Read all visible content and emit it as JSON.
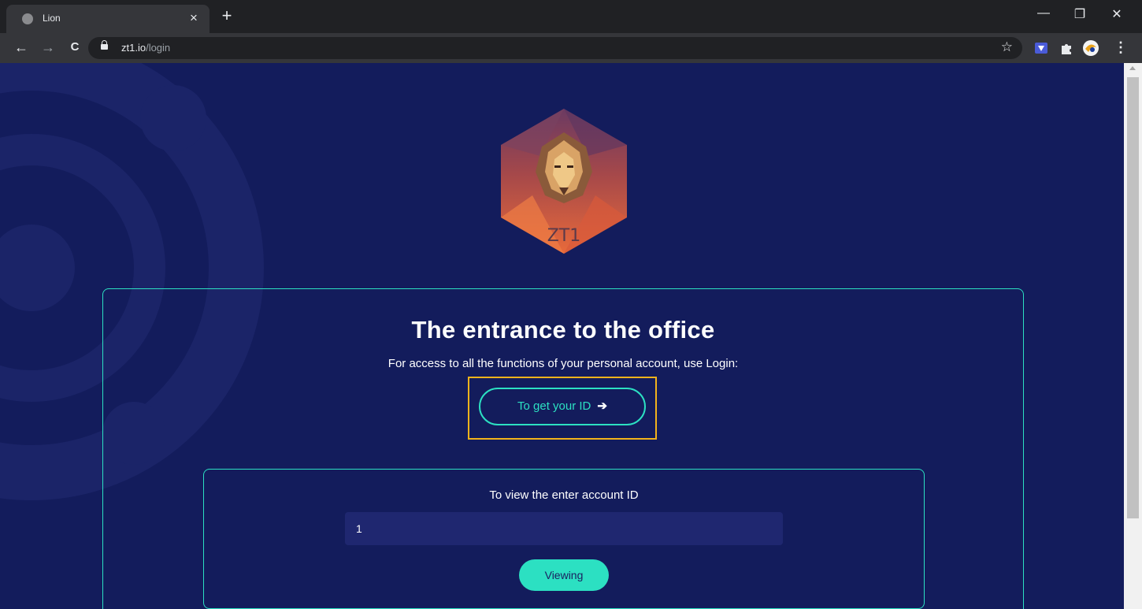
{
  "browser": {
    "tab_title": "Lion",
    "tab_close": "×",
    "new_tab": "+",
    "url_domain": "zt1.io",
    "url_path": "/login",
    "window": {
      "minimize": "—",
      "restore": "❐",
      "close": "✕"
    },
    "nav": {
      "back": "←",
      "forward": "→",
      "reload": "C"
    },
    "bookmark_star": "☆"
  },
  "page": {
    "logo_text": "ZT1",
    "heading": "The entrance to the office",
    "subtitle": "For access to all the functions of your personal account, use Login:",
    "get_id_button": "To get your ID",
    "get_id_arrow": "➔",
    "view_section": {
      "title": "To view the enter account ID",
      "input_value": "1",
      "view_button": "Viewing"
    }
  },
  "colors": {
    "background": "#131c5c",
    "accent": "#2ce0c2",
    "highlight": "#f2b31c"
  }
}
